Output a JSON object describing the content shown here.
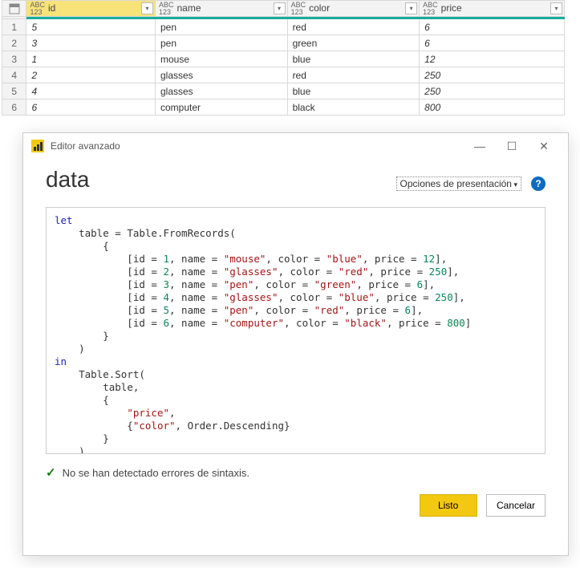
{
  "columns": [
    {
      "name": "id",
      "type": "ABC123"
    },
    {
      "name": "name",
      "type": "ABC123"
    },
    {
      "name": "color",
      "type": "ABC123"
    },
    {
      "name": "price",
      "type": "ABC123"
    }
  ],
  "rows": [
    {
      "n": "1",
      "id": "5",
      "name": "pen",
      "color": "red",
      "price": "6"
    },
    {
      "n": "2",
      "id": "3",
      "name": "pen",
      "color": "green",
      "price": "6"
    },
    {
      "n": "3",
      "id": "1",
      "name": "mouse",
      "color": "blue",
      "price": "12"
    },
    {
      "n": "4",
      "id": "2",
      "name": "glasses",
      "color": "red",
      "price": "250"
    },
    {
      "n": "5",
      "id": "4",
      "name": "glasses",
      "color": "blue",
      "price": "250"
    },
    {
      "n": "6",
      "id": "6",
      "name": "computer",
      "color": "black",
      "price": "800"
    }
  ],
  "dialog": {
    "title": "Editor avanzado",
    "heading": "data",
    "options_label": "Opciones de presentación",
    "help_glyph": "?",
    "status_text": "No se han detectado errores de sintaxis.",
    "btn_ok": "Listo",
    "btn_cancel": "Cancelar"
  },
  "code": {
    "let": "let",
    "table_eq": "table = Table.FromRecords(",
    "r1": {
      "id": "1",
      "name": "\"mouse\"",
      "color": "\"blue\"",
      "price": "12"
    },
    "r2": {
      "id": "2",
      "name": "\"glasses\"",
      "color": "\"red\"",
      "price": "250"
    },
    "r3": {
      "id": "3",
      "name": "\"pen\"",
      "color": "\"green\"",
      "price": "6"
    },
    "r4": {
      "id": "4",
      "name": "\"glasses\"",
      "color": "\"blue\"",
      "price": "250"
    },
    "r5": {
      "id": "5",
      "name": "\"pen\"",
      "color": "\"red\"",
      "price": "6"
    },
    "r6": {
      "id": "6",
      "name": "\"computer\"",
      "color": "\"black\"",
      "price": "800"
    },
    "in": "in",
    "sort": "Table.Sort(",
    "tbl": "table,",
    "price_q": "\"price\"",
    "color_q": "\"color\"",
    "orderdesc": "Order.Descending"
  }
}
